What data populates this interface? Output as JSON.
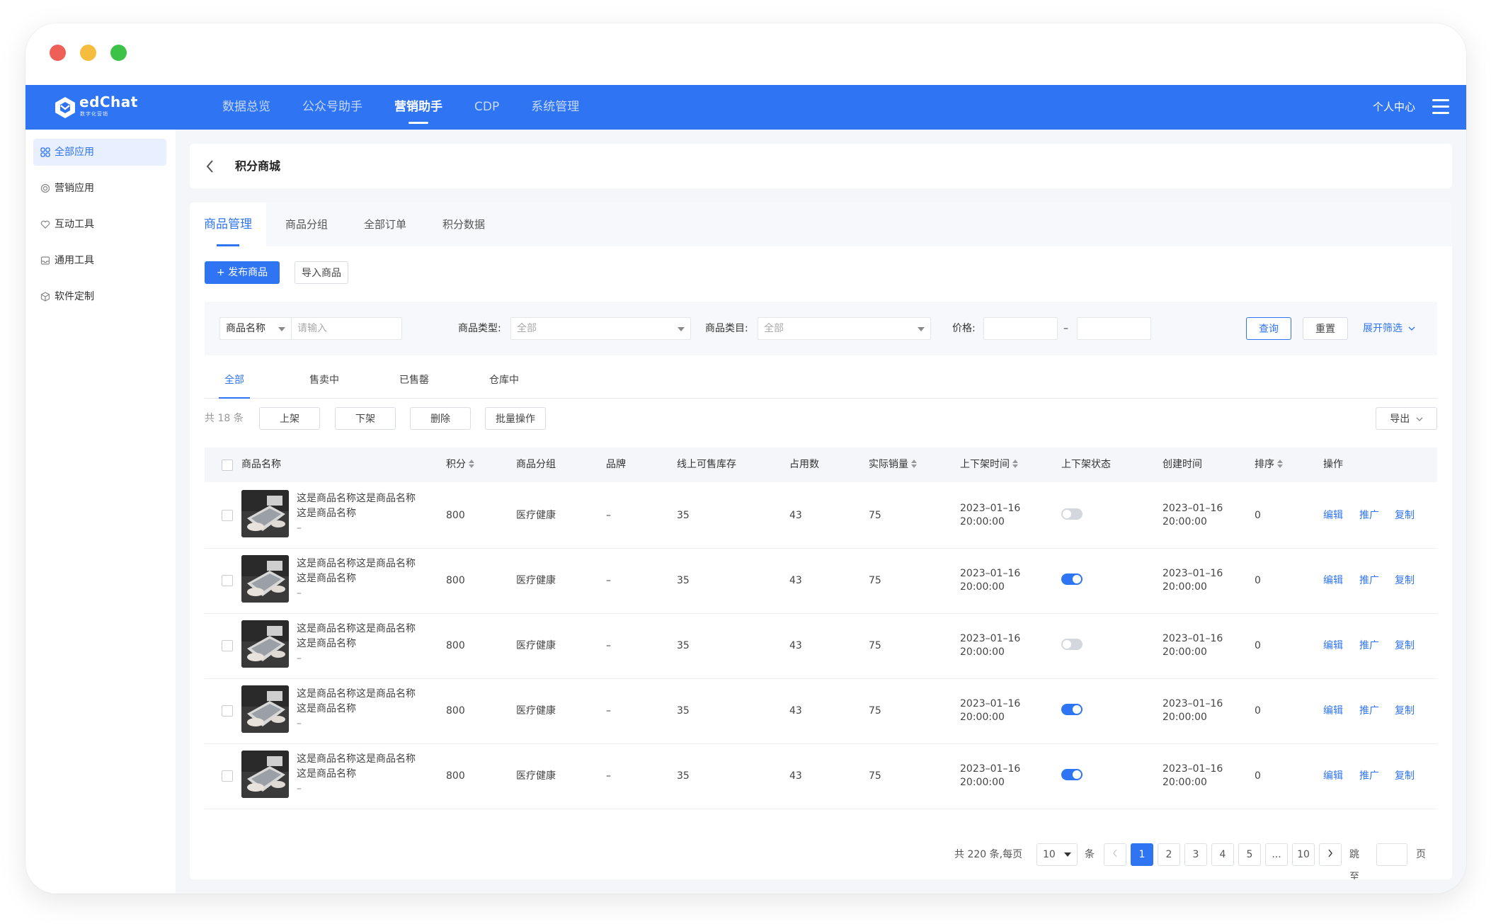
{
  "app": {
    "logo_text": "edChat",
    "logo_sub": "数字化营销"
  },
  "nav": {
    "items": [
      {
        "label": "数据总览"
      },
      {
        "label": "公众号助手"
      },
      {
        "label": "营销助手"
      },
      {
        "label": "CDP"
      },
      {
        "label": "系统管理"
      }
    ],
    "active_index": 2,
    "user_label": "个人中心"
  },
  "sidebar": {
    "items": [
      {
        "label": "全部应用",
        "icon": "grid-icon"
      },
      {
        "label": "营销应用",
        "icon": "target-icon"
      },
      {
        "label": "互动工具",
        "icon": "heart-icon"
      },
      {
        "label": "通用工具",
        "icon": "inbox-icon"
      },
      {
        "label": "软件定制",
        "icon": "cube-icon"
      }
    ],
    "active_index": 0
  },
  "page": {
    "title": "积分商城"
  },
  "tabs": [
    {
      "label": "商品管理"
    },
    {
      "label": "商品分组"
    },
    {
      "label": "全部订单"
    },
    {
      "label": "积分数据"
    }
  ],
  "actions": {
    "publish": "+ 发布商品",
    "import": "导入商品"
  },
  "filter": {
    "name_select": "商品名称",
    "name_placeholder": "请输入",
    "type_label": "商品类型:",
    "type_value": "全部",
    "category_label": "商品类目:",
    "category_value": "全部",
    "price_label": "价格:",
    "price_sep": "–",
    "query": "查询",
    "reset": "重置",
    "expand": "展开筛选"
  },
  "status_tabs": [
    {
      "label": "全部"
    },
    {
      "label": "售卖中"
    },
    {
      "label": "已售罄"
    },
    {
      "label": "仓库中"
    }
  ],
  "toolbar": {
    "total": "共 18 条",
    "on_shelf": "上架",
    "off_shelf": "下架",
    "delete": "删除",
    "batch": "批量操作",
    "export": "导出"
  },
  "table": {
    "headers": {
      "name": "商品名称",
      "points": "积分",
      "group": "商品分组",
      "brand": "品牌",
      "stock": "线上可售库存",
      "occupied": "占用数",
      "sales": "实际销量",
      "shelf_time": "上下架时间",
      "shelf_status": "上下架状态",
      "created": "创建时间",
      "sort": "排序",
      "ops": "操作"
    },
    "rows": [
      {
        "name": "这是商品名称这是商品名称这是商品名称",
        "sub": "–",
        "points": "800",
        "group": "医疗健康",
        "brand": "–",
        "stock": "35",
        "occupied": "43",
        "sales": "75",
        "shelf_date": "2023–01–16",
        "shelf_clock": "20:00:00",
        "on": false,
        "created_date": "2023–01–16",
        "created_clock": "20:00:00",
        "sort": "0",
        "op1": "编辑",
        "op2": "推广",
        "op3": "复制"
      },
      {
        "name": "这是商品名称这是商品名称这是商品名称",
        "sub": "–",
        "points": "800",
        "group": "医疗健康",
        "brand": "–",
        "stock": "35",
        "occupied": "43",
        "sales": "75",
        "shelf_date": "2023–01–16",
        "shelf_clock": "20:00:00",
        "on": true,
        "created_date": "2023–01–16",
        "created_clock": "20:00:00",
        "sort": "0",
        "op1": "编辑",
        "op2": "推广",
        "op3": "复制"
      },
      {
        "name": "这是商品名称这是商品名称这是商品名称",
        "sub": "–",
        "points": "800",
        "group": "医疗健康",
        "brand": "–",
        "stock": "35",
        "occupied": "43",
        "sales": "75",
        "shelf_date": "2023–01–16",
        "shelf_clock": "20:00:00",
        "on": false,
        "created_date": "2023–01–16",
        "created_clock": "20:00:00",
        "sort": "0",
        "op1": "编辑",
        "op2": "推广",
        "op3": "复制"
      },
      {
        "name": "这是商品名称这是商品名称这是商品名称",
        "sub": "–",
        "points": "800",
        "group": "医疗健康",
        "brand": "–",
        "stock": "35",
        "occupied": "43",
        "sales": "75",
        "shelf_date": "2023–01–16",
        "shelf_clock": "20:00:00",
        "on": true,
        "created_date": "2023–01–16",
        "created_clock": "20:00:00",
        "sort": "0",
        "op1": "编辑",
        "op2": "推广",
        "op3": "复制"
      },
      {
        "name": "这是商品名称这是商品名称这是商品名称",
        "sub": "–",
        "points": "800",
        "group": "医疗健康",
        "brand": "–",
        "stock": "35",
        "occupied": "43",
        "sales": "75",
        "shelf_date": "2023–01–16",
        "shelf_clock": "20:00:00",
        "on": true,
        "created_date": "2023–01–16",
        "created_clock": "20:00:00",
        "sort": "0",
        "op1": "编辑",
        "op2": "推广",
        "op3": "复制"
      }
    ]
  },
  "pagination": {
    "summary": "共 220 条,每页",
    "page_size": "10",
    "unit": "条",
    "pages": [
      "1",
      "2",
      "3",
      "4",
      "5",
      "...",
      "10"
    ],
    "current": "1",
    "jump_label": "跳至",
    "page_unit": "页"
  },
  "colors": {
    "primary": "#2f74f3",
    "nav_bg": "#2f74f3"
  }
}
